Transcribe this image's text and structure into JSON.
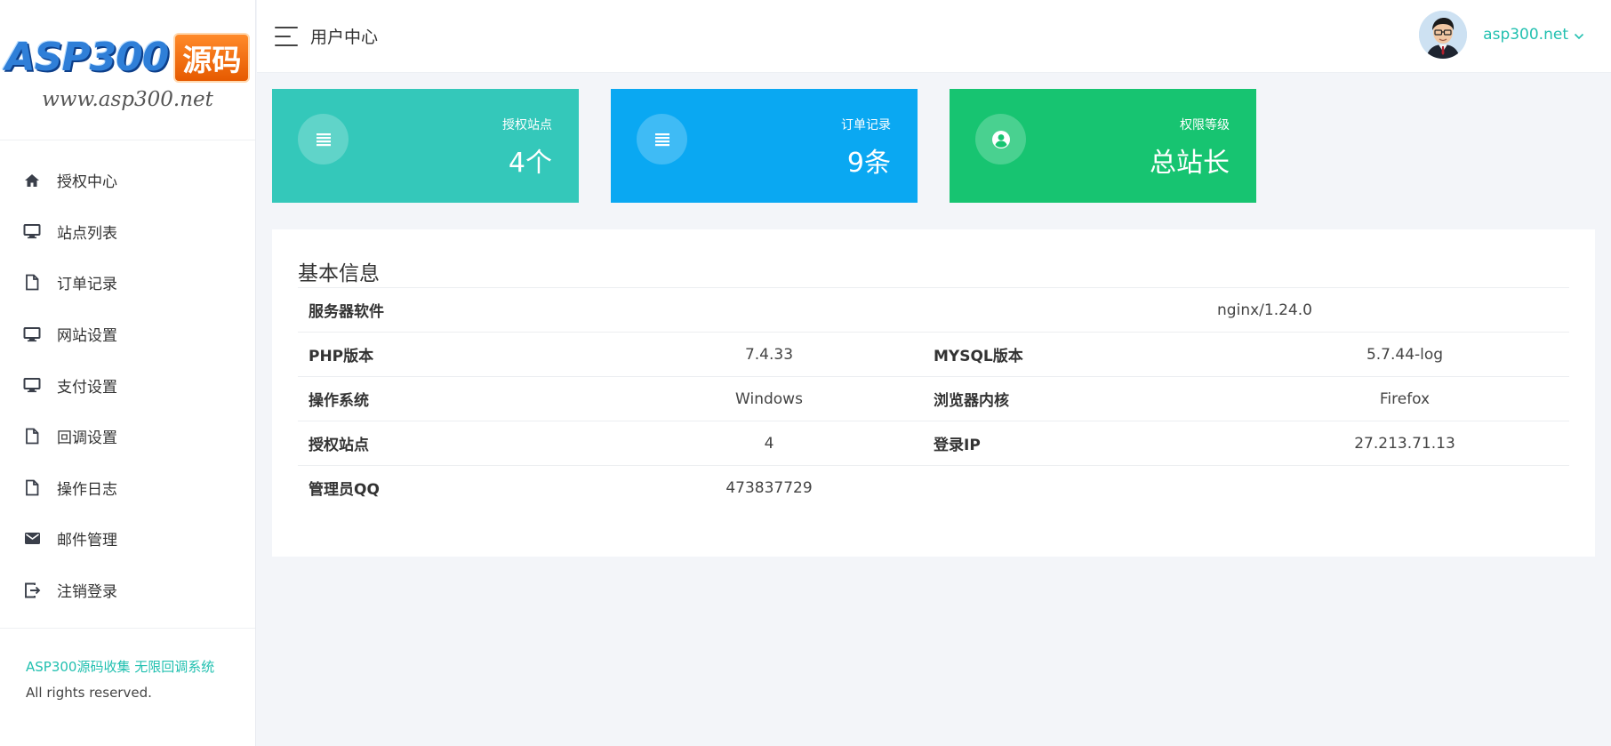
{
  "logo": {
    "main": "ASP300",
    "tag": "源码",
    "url": "www.asp300.net"
  },
  "sidebar": {
    "items": [
      {
        "label": "授权中心",
        "icon": "home-icon"
      },
      {
        "label": "站点列表",
        "icon": "monitor-icon"
      },
      {
        "label": "订单记录",
        "icon": "file-icon"
      },
      {
        "label": "网站设置",
        "icon": "monitor-icon"
      },
      {
        "label": "支付设置",
        "icon": "monitor-icon"
      },
      {
        "label": "回调设置",
        "icon": "file-icon"
      },
      {
        "label": "操作日志",
        "icon": "file-icon"
      },
      {
        "label": "邮件管理",
        "icon": "mail-icon"
      },
      {
        "label": "注销登录",
        "icon": "logout-icon"
      }
    ],
    "footer_brand": "ASP300源码收集 无限回调系统",
    "footer_rights": "All rights reserved."
  },
  "header": {
    "title": "用户中心",
    "username": "asp300.net"
  },
  "cards": [
    {
      "label": "授权站点",
      "value": "4个",
      "color": "#34c8ba",
      "icon": "list-icon"
    },
    {
      "label": "订单记录",
      "value": "9条",
      "color": "#0aa8f2",
      "icon": "list-icon"
    },
    {
      "label": "权限等级",
      "value": "总站长",
      "color": "#17c471",
      "icon": "user-circle-icon"
    }
  ],
  "info": {
    "title": "基本信息",
    "server_software": {
      "label": "服务器软件",
      "value": "nginx/1.24.0"
    },
    "php": {
      "label": "PHP版本",
      "value": "7.4.33"
    },
    "mysql": {
      "label": "MYSQL版本",
      "value": "5.7.44-log"
    },
    "os": {
      "label": "操作系统",
      "value": "Windows"
    },
    "browser": {
      "label": "浏览器内核",
      "value": "Firefox"
    },
    "sites": {
      "label": "授权站点",
      "value": "4"
    },
    "login_ip": {
      "label": "登录IP",
      "value": "27.213.71.13"
    },
    "admin_qq": {
      "label": "管理员QQ",
      "value": "473837729"
    }
  }
}
